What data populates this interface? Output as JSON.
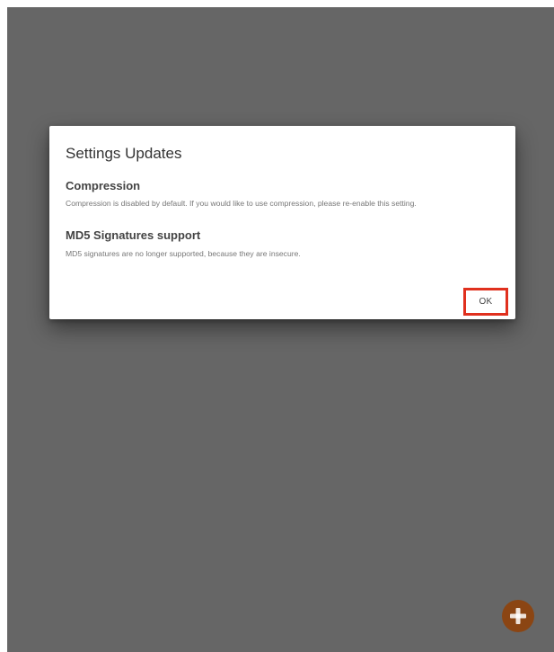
{
  "dialog": {
    "title": "Settings Updates",
    "sections": [
      {
        "heading": "Compression",
        "body": "Compression is disabled by default. If you would like to use compression, please re-enable this setting."
      },
      {
        "heading": "MD5 Signatures support",
        "body": "MD5 signatures are no longer supported, because they are insecure."
      }
    ],
    "ok_label": "OK"
  },
  "fab": {
    "icon": "plus-icon",
    "color": "#8b4513"
  },
  "colors": {
    "backdrop": "#666666",
    "highlight": "#e0301e"
  }
}
